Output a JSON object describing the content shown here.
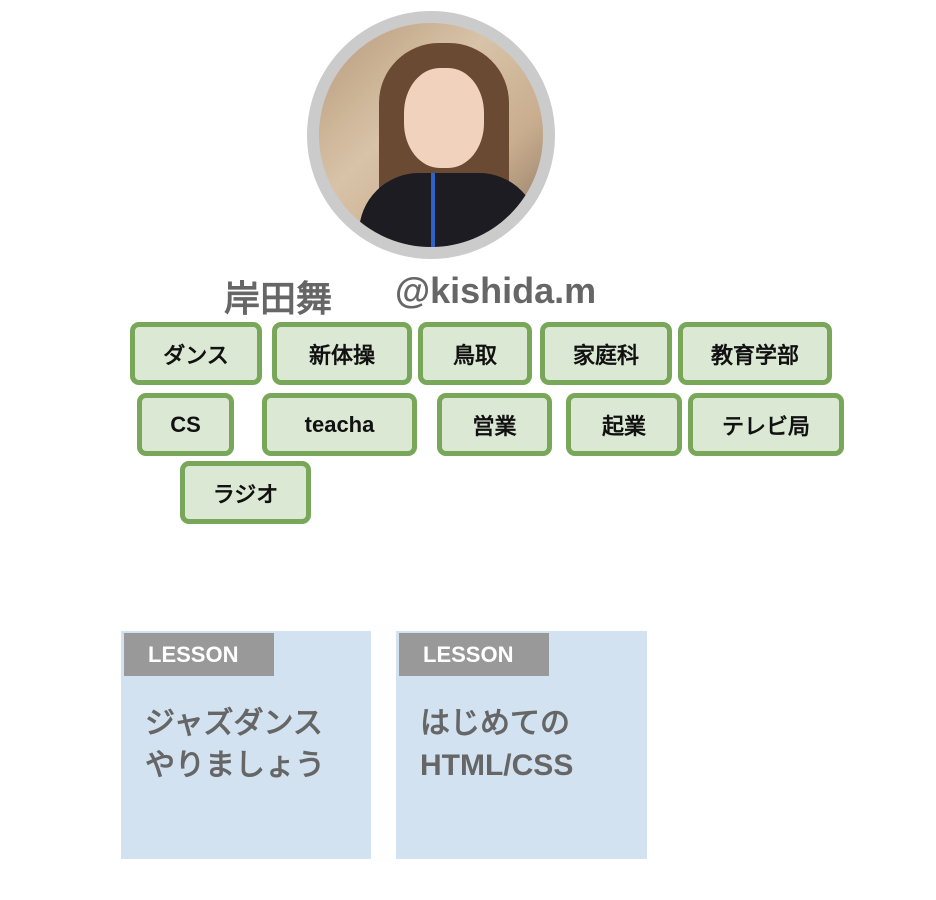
{
  "profile": {
    "name": "岸田舞",
    "handle": "@kishida.m",
    "colors": {
      "tag_border": "#79a75a",
      "tag_bg": "#dbe8d4",
      "card_bg": "#d2e2f0",
      "label_bg": "#999999"
    }
  },
  "tags": [
    "ダンス",
    "新体操",
    "鳥取",
    "家庭科",
    "教育学部",
    "CS",
    "teacha",
    "営業",
    "起業",
    "テレビ局",
    "ラジオ"
  ],
  "lessons": [
    {
      "label": "LESSON",
      "title": "ジャズダンス\nやりましょう"
    },
    {
      "label": "LESSON",
      "title": "はじめての\nHTML/CSS"
    }
  ]
}
